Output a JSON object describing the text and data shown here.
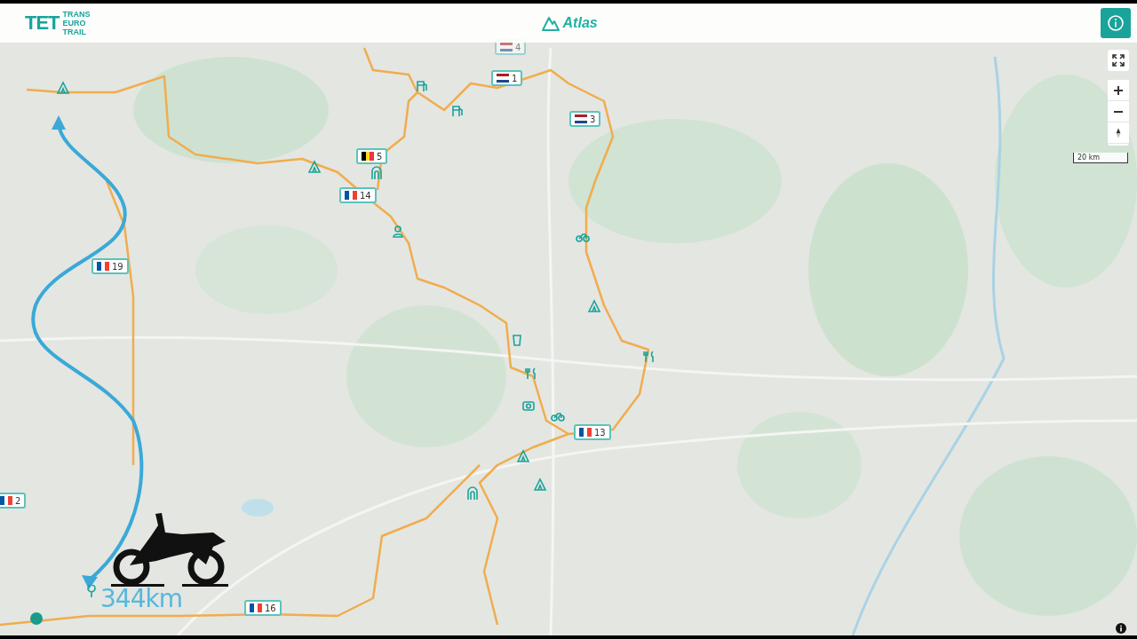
{
  "header": {
    "logo_word": "TET",
    "logo_lines": [
      "TRANS",
      "EURO",
      "TRAIL"
    ],
    "section": "Atlas"
  },
  "map_controls": {
    "scale": "20 km"
  },
  "markers": [
    {
      "kind": "nl",
      "number": "4",
      "faded": true
    },
    {
      "kind": "nl",
      "number": "1",
      "faded": false
    },
    {
      "kind": "nl",
      "number": "3",
      "faded": false
    },
    {
      "kind": "be",
      "number": "5",
      "faded": false
    },
    {
      "kind": "fr",
      "number": "14",
      "faded": false
    },
    {
      "kind": "fr",
      "number": "19",
      "faded": false
    },
    {
      "kind": "fr",
      "number": "13",
      "faded": false
    },
    {
      "kind": "fr",
      "number": "2",
      "faded": false
    },
    {
      "kind": "fr",
      "number": "16",
      "faded": false
    }
  ],
  "overlay": {
    "distance": "344km"
  }
}
